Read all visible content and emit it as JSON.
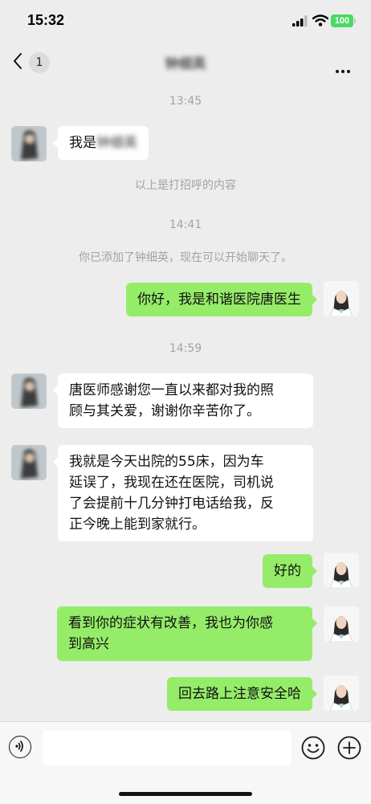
{
  "status_bar": {
    "time": "15:32",
    "battery": "100"
  },
  "nav": {
    "back_count": "1",
    "title": "钟细英"
  },
  "chat": {
    "ts1": "13:45",
    "msg1_prefix": "我是",
    "msg1_name": "钟细英",
    "sys1": "以上是打招呼的内容",
    "ts2": "14:41",
    "sys2": "你已添加了钟细英，现在可以开始聊天了。",
    "msg2": "你好，我是和谐医院唐医生",
    "ts3": "14:59",
    "msg3_line1": "唐医师感谢您一直以来都对我的照",
    "msg3_line2": "顾与其关爱，谢谢你辛苦你了。",
    "msg4_line1": "我就是今天出院的55床，因为车",
    "msg4_line2": "延误了，我现在还在医院，司机说",
    "msg4_line3": "了会提前十几分钟打电话给我，反",
    "msg4_line4": "正今晚上能到家就行。",
    "msg5": "好的",
    "msg6_line1": "看到你的症状有改善，我也为你感",
    "msg6_line2": "到高兴",
    "msg7": "回去路上注意安全哈"
  },
  "colors": {
    "background": "#ededed",
    "self_bubble": "#95ec69",
    "peer_bubble": "#ffffff",
    "battery": "#4cd964"
  },
  "icons": {
    "back": "chevron-left-icon",
    "more": "more-dots-icon",
    "voice": "voice-icon",
    "emoji": "emoji-icon",
    "plus": "plus-icon"
  }
}
